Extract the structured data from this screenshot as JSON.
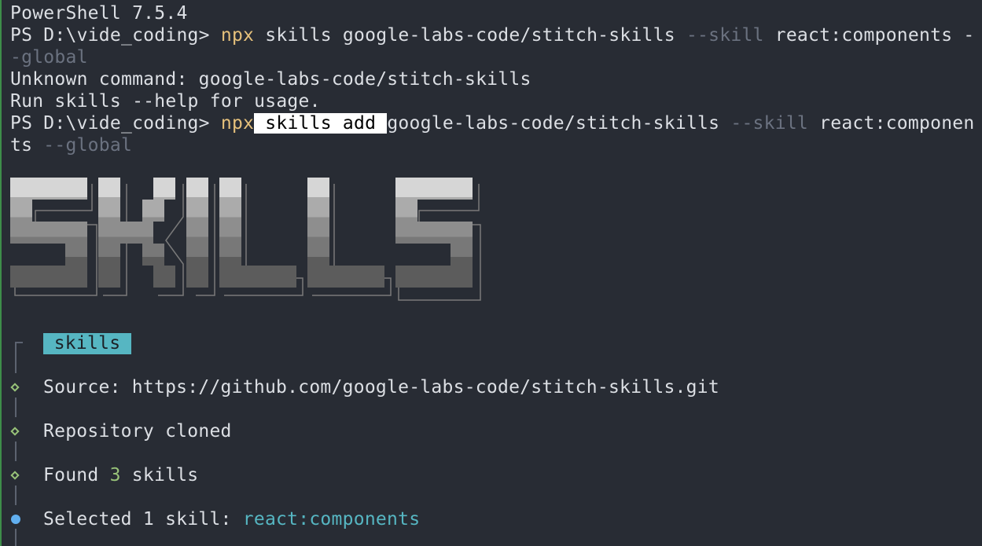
{
  "terminal": {
    "header": "PowerShell 7.5.4",
    "cmd1": {
      "prompt": "PS D:\\vide_coding> ",
      "npx": "npx",
      "rest": " skills google-labs-code/stitch-skills ",
      "flag": "--skill",
      "arg": " react:components -",
      "wrap_flag": "-global"
    },
    "error1": "Unknown command: google-labs-code/stitch-skills",
    "error2": "Run skills --help for usage.",
    "cmd2": {
      "prompt": "PS D:\\vide_coding> ",
      "npx": "npx",
      "highlight": " skills add ",
      "rest": "google-labs-code/stitch-skills ",
      "flag": "--skill",
      "arg": " react:componen",
      "wrap_arg": "ts ",
      "wrap_flag": "--global"
    }
  },
  "banner": {
    "logo_text": "SKILLS",
    "colors": [
      "#d4d4d4",
      "#a9a9a9",
      "#8c8c8c",
      "#777777",
      "#6a6a6a",
      "#5a5a5a"
    ]
  },
  "cli": {
    "title_badge": "skills",
    "source_label": "Source: ",
    "source_url": "https://github.com/google-labs-code/stitch-skills.git",
    "repo_status": "Repository cloned",
    "found_prefix": "Found ",
    "found_count": "3",
    "found_suffix": " skills",
    "selected_prefix": "Selected 1 skill: ",
    "selected_value": "react:components"
  }
}
